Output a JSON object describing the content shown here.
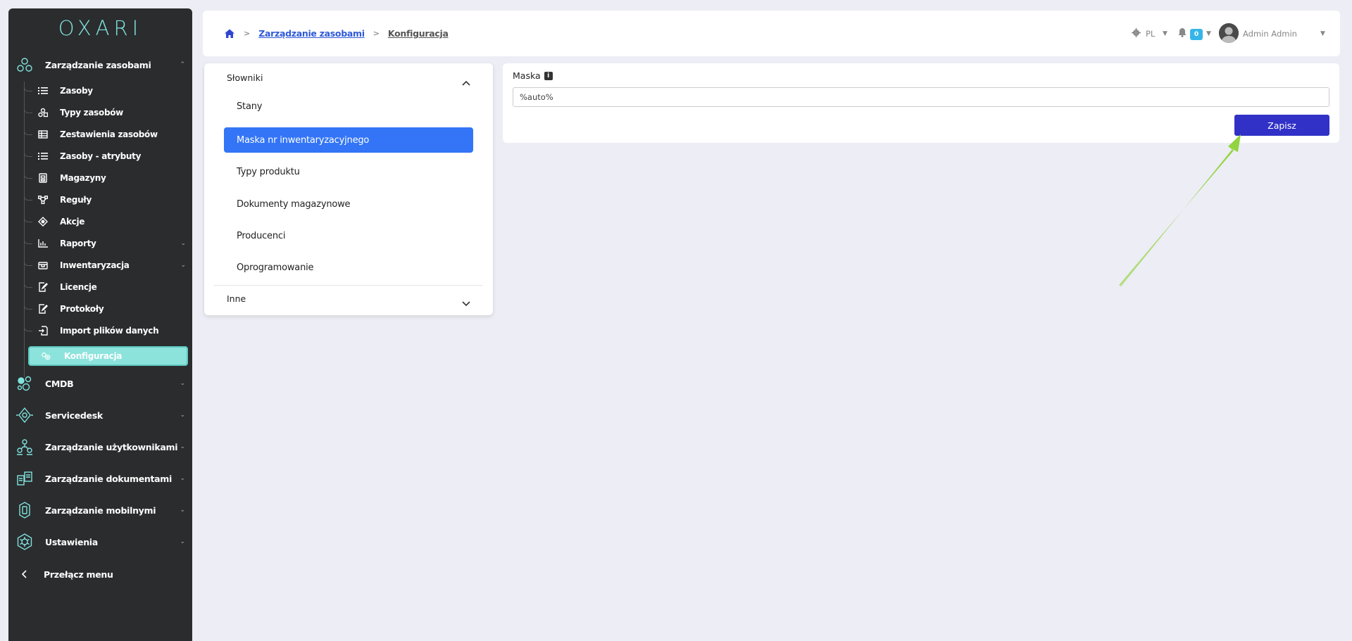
{
  "colors": {
    "sidebar_bg": "#2b2c2e",
    "accent_teal": "#8ce3dc",
    "selected_item": "#3375f6",
    "save_button": "#3131c8",
    "arrow": "#8fd43b"
  },
  "sidebar": {
    "logo": "OXARI",
    "asset_management": {
      "label": "Zarządzanie zasobami",
      "icon": "nodes-icon",
      "items": [
        {
          "label": "Zasoby",
          "icon": "list-icon"
        },
        {
          "label": "Typy zasobów",
          "icon": "shapes-icon"
        },
        {
          "label": "Zestawienia zasobów",
          "icon": "table-icon"
        },
        {
          "label": "Zasoby - atrybuty",
          "icon": "list-icon"
        },
        {
          "label": "Magazyny",
          "icon": "warehouse-icon"
        },
        {
          "label": "Reguły",
          "icon": "rules-icon"
        },
        {
          "label": "Akcje",
          "icon": "action-icon"
        },
        {
          "label": "Raporty",
          "icon": "chart-icon"
        },
        {
          "label": "Inwentaryzacja",
          "icon": "inventory-icon"
        },
        {
          "label": "Licencje",
          "icon": "license-icon"
        },
        {
          "label": "Protokoły",
          "icon": "protocol-icon"
        },
        {
          "label": "Import plików danych",
          "icon": "import-icon"
        },
        {
          "label": "Konfiguracja",
          "icon": "config-icon"
        }
      ]
    },
    "sections": [
      {
        "label": "CMDB",
        "icon": "cmdb-icon"
      },
      {
        "label": "Servicedesk",
        "icon": "servicedesk-icon"
      },
      {
        "label": "Zarządzanie użytkownikami",
        "icon": "users-icon"
      },
      {
        "label": "Zarządzanie dokumentami",
        "icon": "documents-icon"
      },
      {
        "label": "Zarządzanie mobilnymi",
        "icon": "mobile-icon"
      },
      {
        "label": "Ustawienia",
        "icon": "settings-icon"
      }
    ],
    "toggle": "Przełącz menu"
  },
  "header": {
    "breadcrumb": {
      "level1": "Zarządzanie zasobami",
      "level2": "Konfiguracja"
    },
    "language": "PL",
    "notifications": "0",
    "user": "Admin Admin"
  },
  "dictionaries": {
    "section1": "Słowniki",
    "items": [
      "Stany",
      "Maska nr inwentaryzacyjnego",
      "Typy produktu",
      "Dokumenty magazynowe",
      "Producenci",
      "Oprogramowanie"
    ],
    "selected_index": 1,
    "section2": "Inne"
  },
  "form": {
    "label": "Maska",
    "value": "%auto%",
    "save": "Zapisz"
  }
}
